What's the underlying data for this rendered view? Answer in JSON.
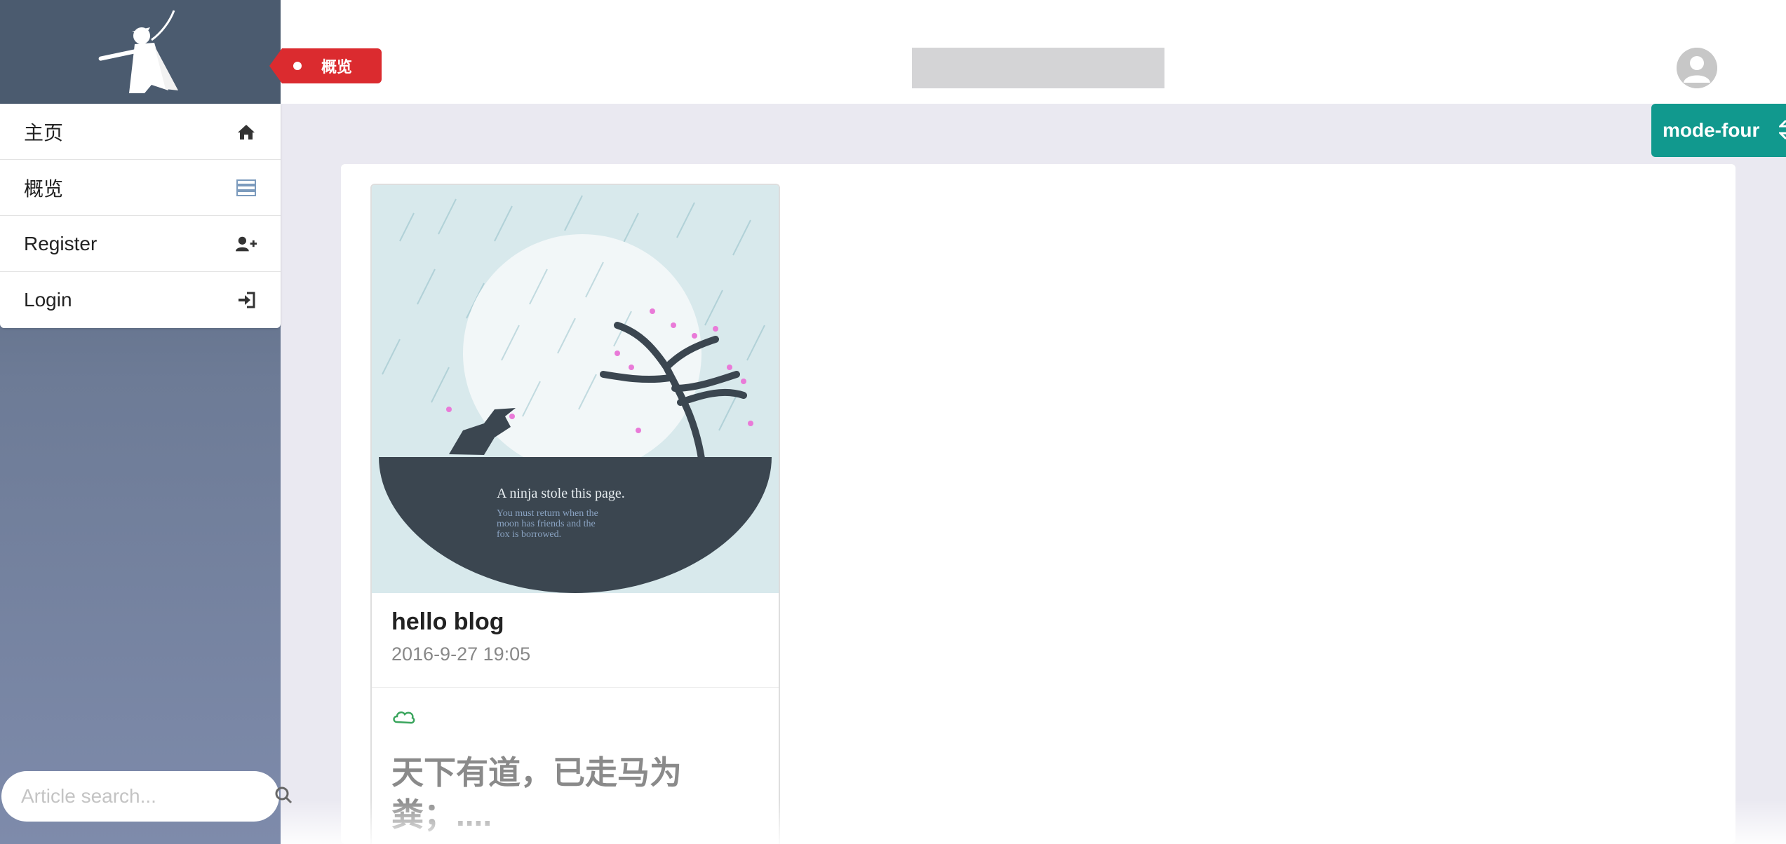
{
  "sidebar": {
    "menu": [
      {
        "label": "主页",
        "icon": "home-icon"
      },
      {
        "label": "概览",
        "icon": "server-icon"
      },
      {
        "label": "Register",
        "icon": "user-plus-icon"
      },
      {
        "label": "Login",
        "icon": "sign-in-icon"
      }
    ],
    "search": {
      "placeholder": "Article search..."
    }
  },
  "header": {
    "page_tag": "概览"
  },
  "mode_button": {
    "label": "mode-four"
  },
  "card": {
    "image_caption": "A ninja stole this page.",
    "image_subcaption_lines": [
      "You must return when the",
      "moon has friends and the",
      "fox is borrowed."
    ],
    "title": "hello blog",
    "date": "2016-9-27 19:05",
    "excerpt": "天下有道，已走马为粪；...."
  },
  "colors": {
    "accent_red": "#db2b2f",
    "accent_teal": "#11998e",
    "sidebar_top": "#4b5b6f"
  }
}
